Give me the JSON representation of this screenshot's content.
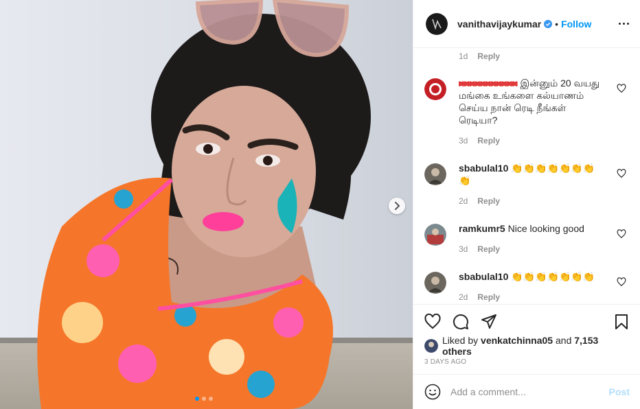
{
  "post": {
    "author": "vanithavijaykumar",
    "follow_label": "Follow",
    "bullet": "•",
    "verified": true
  },
  "top_meta": {
    "time": "1d",
    "reply": "Reply"
  },
  "comments": [
    {
      "username": "xxxxxxxxxxx",
      "text": "இன்னும் 20 வயது மங்கை உங்களை கல்யாணம் செய்ய நான் ரெடி நீங்கள் ரெடியா?",
      "time": "3d",
      "reply": "Reply"
    },
    {
      "username": "sbabulal10",
      "text": "👏👏👏👏👏👏👏👏",
      "time": "2d",
      "reply": "Reply"
    },
    {
      "username": "ramkumr5",
      "text": "Nice looking good",
      "time": "3d",
      "reply": "Reply"
    },
    {
      "username": "sbabulal10",
      "text": "👏👏👏👏👏👏👏",
      "time": "2d",
      "reply": "Reply"
    }
  ],
  "likes": {
    "prefix": "Liked by",
    "user": "venkatchinna05",
    "and": "and",
    "others": "7,153 others"
  },
  "date": "3 DAYS AGO",
  "add_comment": {
    "placeholder": "Add a comment...",
    "post_label": "Post"
  },
  "carousel": {
    "total": 3,
    "active": 1
  },
  "colors": {
    "accent": "#0095f6",
    "post_disabled": "#b2dffc",
    "muted": "#8e8e8e",
    "text": "#262626"
  }
}
